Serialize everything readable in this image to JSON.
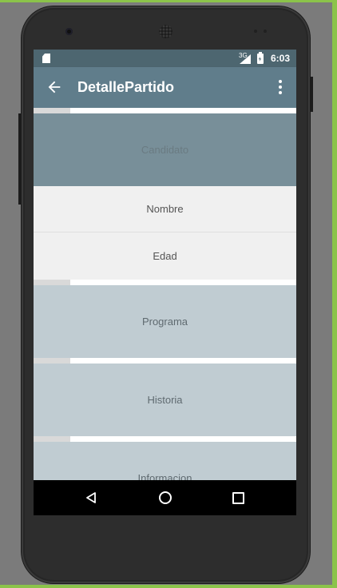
{
  "status_bar": {
    "network_type": "3G",
    "time": "6:03",
    "icons": [
      "sd-card-icon",
      "signal-icon",
      "battery-charging-icon"
    ]
  },
  "app_bar": {
    "title": "DetallePartido",
    "nav_icon": "arrow-back-icon",
    "menu_icon": "more-vert-icon"
  },
  "sections": [
    {
      "label": "Candidato",
      "expanded": true,
      "children": [
        "Nombre",
        "Edad"
      ]
    },
    {
      "label": "Programa",
      "expanded": false
    },
    {
      "label": "Historia",
      "expanded": false
    },
    {
      "label": "Informacion",
      "expanded": false
    }
  ],
  "nav_bar": {
    "icons": [
      "back-triangle-icon",
      "home-circle-icon",
      "recents-square-icon"
    ]
  },
  "colors": {
    "status_bar": "#4d6670",
    "app_bar": "#607d8b",
    "header_expanded": "#788f99",
    "header_collapsed": "#c0ccd2",
    "child_row": "#f0f0f0",
    "device_frame_accent": "#8bc34a"
  }
}
